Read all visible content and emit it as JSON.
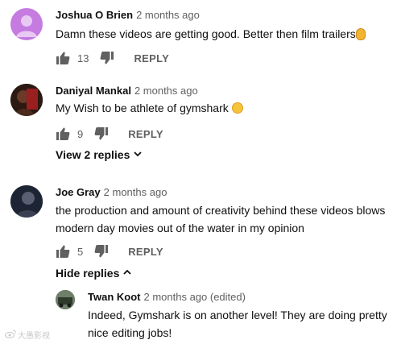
{
  "comments": [
    {
      "author": "Joshua O Brien",
      "time": "2 months ago",
      "text": "Damn these videos are getting good. Better then film trailers",
      "likes": "13",
      "reply_label": "REPLY"
    },
    {
      "author": "Daniyal Mankal",
      "time": "2 months ago",
      "text": "My Wish to be athlete of gymshark",
      "likes": "9",
      "reply_label": "REPLY",
      "view_replies": "View 2 replies"
    },
    {
      "author": "Joe Gray",
      "time": "2 months ago",
      "text": "the production and amount of creativity behind these videos blows modern day movies out of the water in my opinion",
      "likes": "5",
      "reply_label": "REPLY",
      "hide_replies": "Hide replies"
    }
  ],
  "reply": {
    "author": "Twan Koot",
    "time": "2 months ago (edited)",
    "text": "Indeed, Gymshark is on another level! They are doing pretty nice editing jobs!"
  },
  "watermark": "大愚影视",
  "colors": {
    "avatar_default": "#c57be0",
    "meta_text": "#606060",
    "text": "#0f0f0f"
  }
}
